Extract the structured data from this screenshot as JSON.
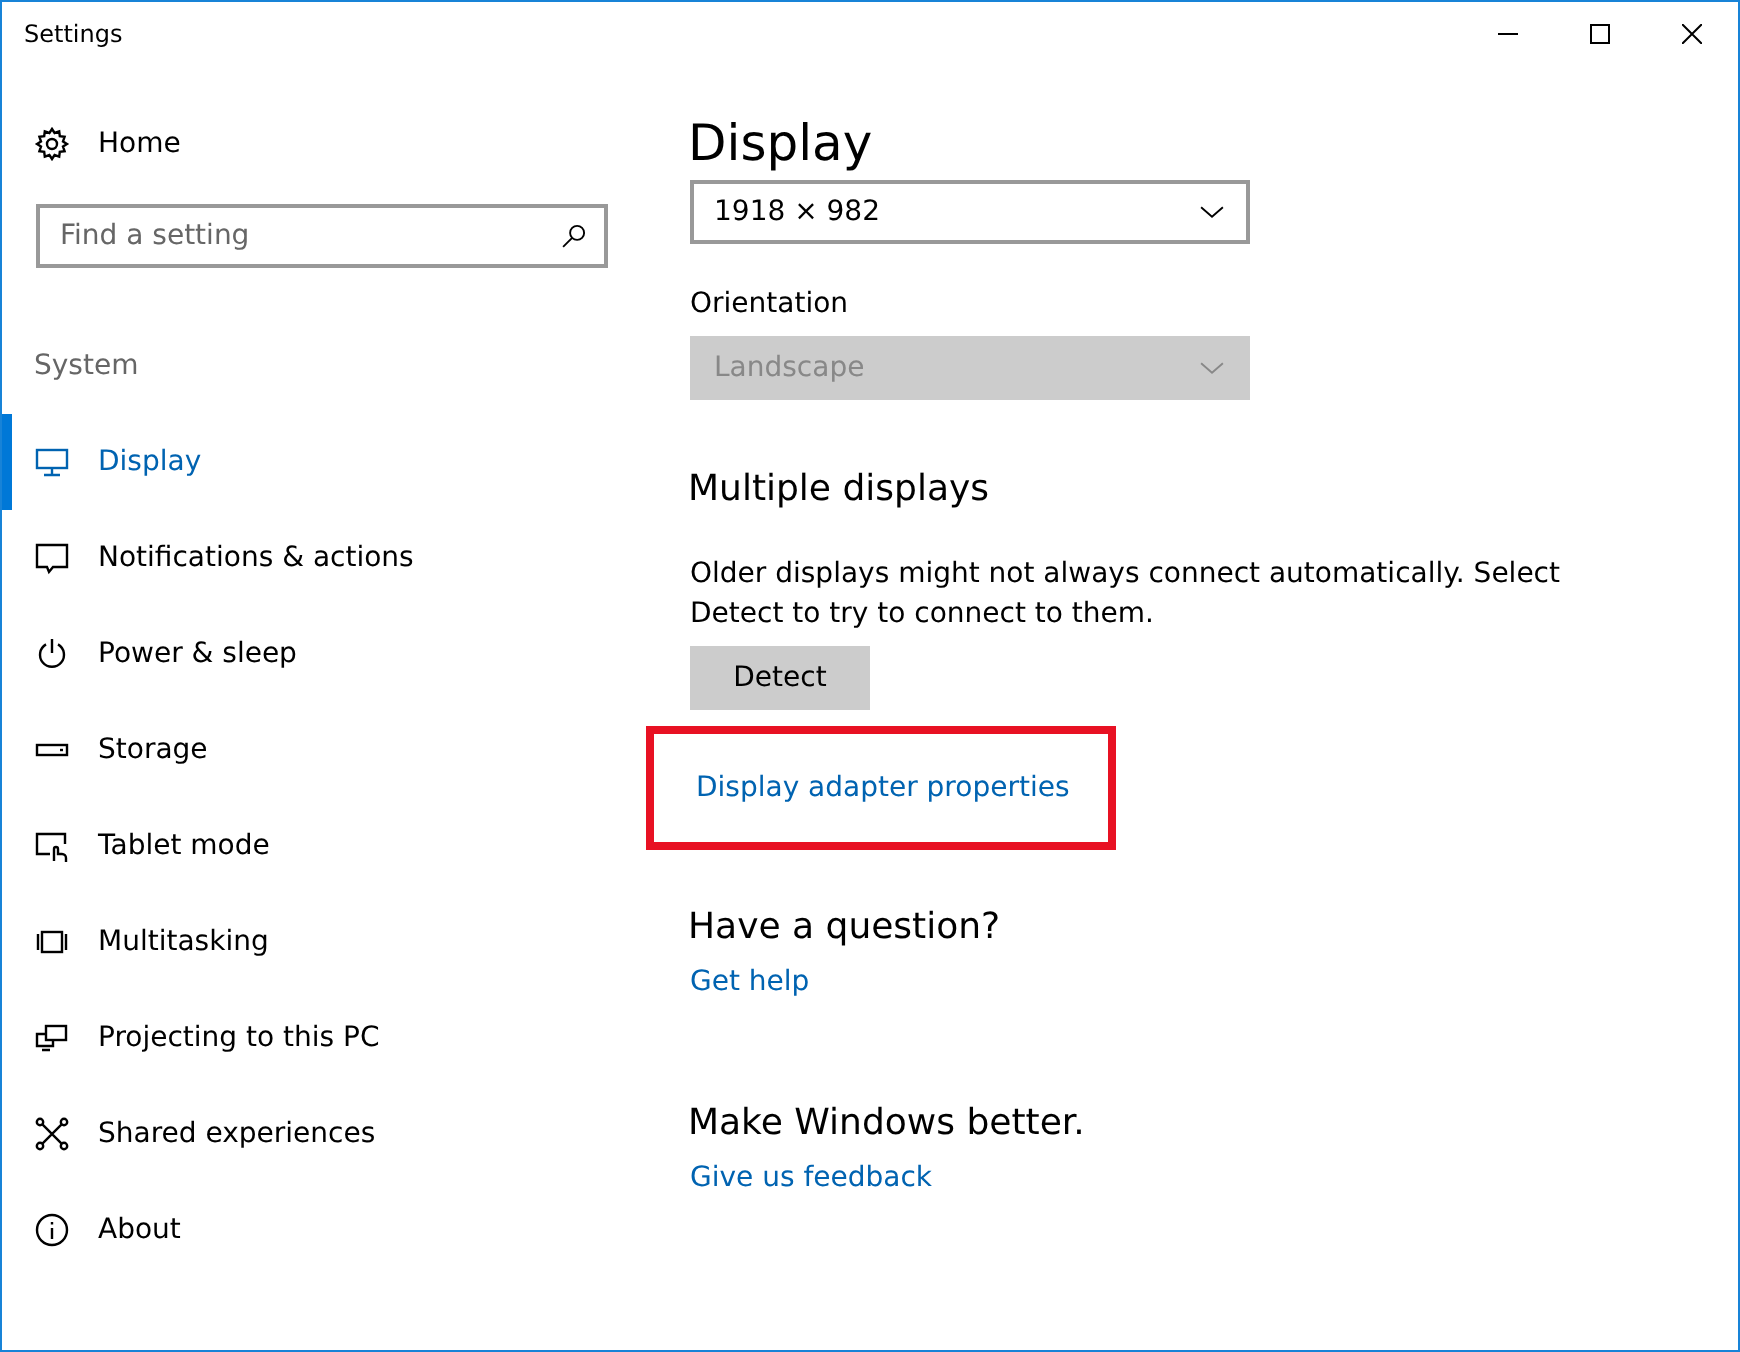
{
  "window": {
    "title": "Settings"
  },
  "sidebar": {
    "home": "Home",
    "search": {
      "placeholder": "Find a setting"
    },
    "section": "System",
    "items": [
      {
        "label": "Display",
        "selected": true
      },
      {
        "label": "Notifications & actions",
        "selected": false
      },
      {
        "label": "Power & sleep",
        "selected": false
      },
      {
        "label": "Storage",
        "selected": false
      },
      {
        "label": "Tablet mode",
        "selected": false
      },
      {
        "label": "Multitasking",
        "selected": false
      },
      {
        "label": "Projecting to this PC",
        "selected": false
      },
      {
        "label": "Shared experiences",
        "selected": false
      },
      {
        "label": "About",
        "selected": false
      }
    ]
  },
  "content": {
    "title": "Display",
    "resolution": {
      "value": "1918 × 982",
      "disabled": false
    },
    "orientation": {
      "label": "Orientation",
      "value": "Landscape",
      "disabled": true
    },
    "multiple_displays": {
      "heading": "Multiple displays",
      "text": "Older displays might not always connect automatically. Select Detect to try to connect to them.",
      "button": "Detect",
      "link": "Display adapter properties",
      "highlighted": true
    },
    "question": {
      "heading": "Have a question?",
      "link": "Get help"
    },
    "feedback": {
      "heading": "Make Windows better.",
      "link": "Give us feedback"
    }
  }
}
